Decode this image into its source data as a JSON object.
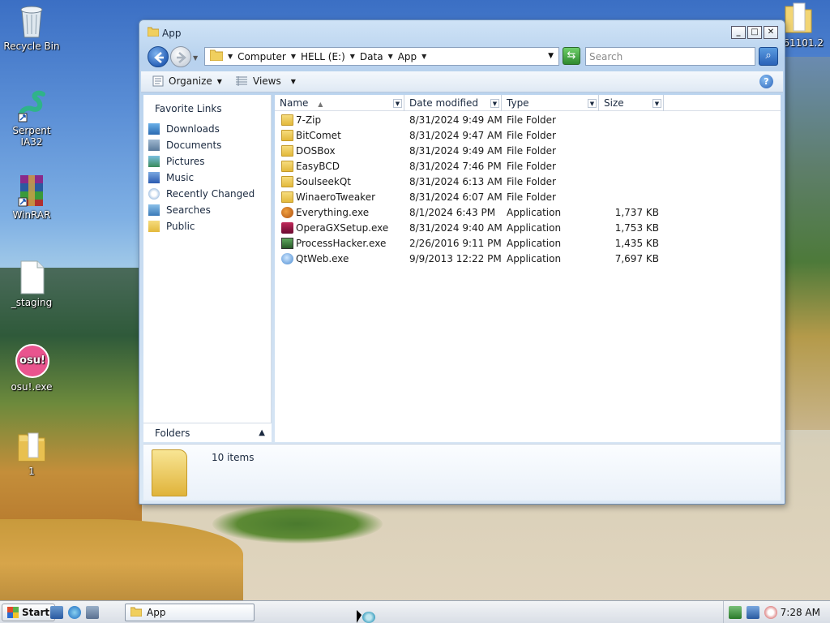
{
  "desktop": {
    "icons": [
      {
        "label": "Recycle Bin"
      },
      {
        "label": "Serpent IA32"
      },
      {
        "label": "WinRAR"
      },
      {
        "label": "_staging"
      },
      {
        "label": "osu!.exe",
        "badge": "osu!"
      },
      {
        "label": "1"
      },
      {
        "label": "61101.2"
      }
    ]
  },
  "window": {
    "title": "App",
    "caption": {
      "minimize": "_",
      "maximize": "□",
      "close": "✕"
    },
    "address": {
      "crumbs": [
        "Computer",
        "HELL (E:)",
        "Data",
        "App"
      ]
    },
    "search_placeholder": "Search",
    "toolbar": {
      "organize": "Organize",
      "views": "Views"
    },
    "nav": {
      "header": "Favorite Links",
      "links": [
        "Downloads",
        "Documents",
        "Pictures",
        "Music",
        "Recently Changed",
        "Searches",
        "Public"
      ],
      "folders": "Folders"
    },
    "columns": [
      "Name",
      "Date modified",
      "Type",
      "Size"
    ],
    "files": [
      {
        "name": "7-Zip",
        "date": "8/31/2024 9:49 AM",
        "type": "File Folder",
        "size": "",
        "icon": "folder-icon"
      },
      {
        "name": "BitComet",
        "date": "8/31/2024 9:47 AM",
        "type": "File Folder",
        "size": "",
        "icon": "folder-icon"
      },
      {
        "name": "DOSBox",
        "date": "8/31/2024 9:49 AM",
        "type": "File Folder",
        "size": "",
        "icon": "folder-icon"
      },
      {
        "name": "EasyBCD",
        "date": "8/31/2024 7:46 PM",
        "type": "File Folder",
        "size": "",
        "icon": "folder-icon"
      },
      {
        "name": "SoulseekQt",
        "date": "8/31/2024 6:13 AM",
        "type": "File Folder",
        "size": "",
        "icon": "folder-icon"
      },
      {
        "name": "WinaeroTweaker",
        "date": "8/31/2024 6:07 AM",
        "type": "File Folder",
        "size": "",
        "icon": "folder-icon"
      },
      {
        "name": "Everything.exe",
        "date": "8/1/2024 6:43 PM",
        "type": "Application",
        "size": "1,737 KB",
        "icon": "everything-icon"
      },
      {
        "name": "OperaGXSetup.exe",
        "date": "8/31/2024 9:40 AM",
        "type": "Application",
        "size": "1,753 KB",
        "icon": "opera-gx-icon"
      },
      {
        "name": "ProcessHacker.exe",
        "date": "2/26/2016 9:11 PM",
        "type": "Application",
        "size": "1,435 KB",
        "icon": "process-hacker-icon"
      },
      {
        "name": "QtWeb.exe",
        "date": "9/9/2013 12:22 PM",
        "type": "Application",
        "size": "7,697 KB",
        "icon": "qtweb-icon"
      }
    ],
    "details": {
      "item_count": "10 items"
    }
  },
  "taskbar": {
    "start": "Start",
    "task": "App",
    "clock": "7:28 AM"
  }
}
